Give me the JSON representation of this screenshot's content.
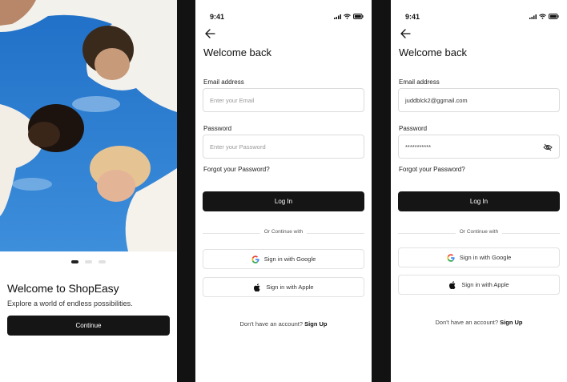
{
  "onboarding": {
    "title": "Welcome to ShopEasy",
    "subtitle": "Explore a world of endless possibilities.",
    "continue_label": "Continue",
    "page_indicator": {
      "total": 3,
      "active": 1
    }
  },
  "login_empty": {
    "time": "9:41",
    "title": "Welcome back",
    "email_label": "Email address",
    "email_placeholder": "Enter your Email",
    "password_label": "Password",
    "password_placeholder": "Enter your Password",
    "forgot": "Forgot your Password?",
    "login_label": "Log In",
    "divider": "Or Continue with",
    "google_label": "Sign in with Google",
    "apple_label": "Sign in with Apple",
    "signup_prompt": "Don't have an account?",
    "signup_link": "Sign Up"
  },
  "login_filled": {
    "time": "9:41",
    "title": "Welcome back",
    "email_label": "Email address",
    "email_value": "juddblck2@ggmail.com",
    "password_label": "Password",
    "password_value": "***********",
    "forgot": "Forgot your Password?",
    "login_label": "Log In",
    "divider": "Or Continue with",
    "google_label": "Sign in with Google",
    "apple_label": "Sign in with Apple",
    "signup_prompt": "Don't have an account?",
    "signup_link": "Sign Up"
  },
  "colors": {
    "primary_button": "#151515",
    "background": "#ffffff",
    "separator": "#121212"
  },
  "icons": [
    "back-arrow-icon",
    "google-icon",
    "apple-icon",
    "eye-off-icon",
    "signal-icon",
    "wifi-icon",
    "battery-icon"
  ]
}
